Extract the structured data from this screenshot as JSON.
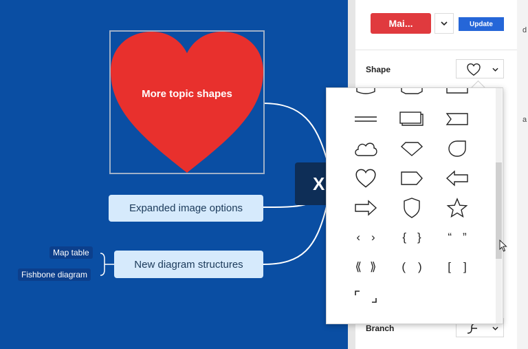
{
  "canvas": {
    "heart_topic": "More topic shapes",
    "topics": [
      {
        "label": "Expanded image options"
      },
      {
        "label": "New diagram structures"
      }
    ],
    "subtopics": [
      {
        "label": "Map table"
      },
      {
        "label": "Fishbone diagram"
      }
    ],
    "central_topic": "X"
  },
  "panel": {
    "style_button": "Mai...",
    "update_button": "Update",
    "shape_label": "Shape",
    "branch_label": "Branch",
    "right_edge_glyphs": [
      "d",
      "a"
    ]
  },
  "shape_popup": {
    "rows": [
      [
        "rounded-tab-shape",
        "banner-tab-shape",
        "rectangle-tab-shape"
      ],
      [
        "double-line-shape",
        "stacked-rectangles-shape",
        "flag-shape"
      ],
      [
        "cloud-shape",
        "diamond-gem-shape",
        "leaf-drop-shape"
      ],
      [
        "heart-shape",
        "tag-pentagon-shape",
        "left-arrow-shape"
      ],
      [
        "right-arrow-shape",
        "shield-shape",
        "star-shape"
      ],
      [
        "angle-brackets-shape",
        "curly-braces-shape",
        "quotes-shape"
      ],
      [
        "double-angle-brackets-shape",
        "parentheses-shape",
        "square-brackets-shape"
      ],
      [
        "corner-brackets-shape"
      ]
    ],
    "glyphs": {
      "angle": [
        "‹",
        "›"
      ],
      "curly": [
        "{",
        "}"
      ],
      "quotes": [
        "“",
        "”"
      ],
      "double_angle": [
        "⟪",
        "⟫"
      ],
      "paren": [
        "(",
        ")"
      ],
      "square": [
        "[",
        "]"
      ],
      "corner": [
        "⌜",
        "⌟"
      ]
    }
  },
  "colors": {
    "canvas_bg": "#0a4ea3",
    "heart_fill": "#e8302d",
    "topic_bg": "#d6eafc",
    "central_bg": "#0e2e57",
    "accent_red": "#e03a3e",
    "accent_blue": "#2566d8"
  }
}
